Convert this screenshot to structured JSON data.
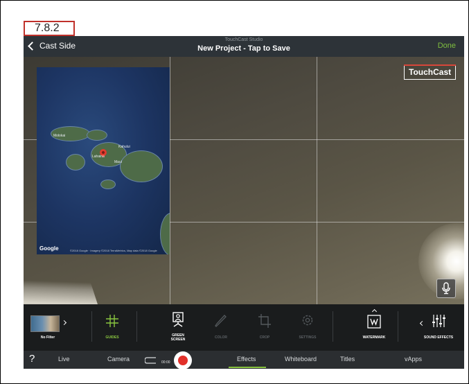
{
  "step_label": "7.8.2",
  "topbar": {
    "back_label": "Cast Side",
    "app_name": "TouchCast Studio",
    "project_title": "New Project - Tap to Save",
    "done_label": "Done"
  },
  "preview": {
    "logo_text": "TouchCast",
    "map": {
      "google_label": "Google",
      "attribution": "©2018 Google · Imagery ©2018 TerraMetrics, Map data ©2018 Google",
      "place_labels": [
        "Molokai",
        "Kahului",
        "Lahaina",
        "Maui"
      ]
    }
  },
  "effects": {
    "filter_label": "No Filter",
    "guides_label": "GUIDES",
    "green_screen_label": "GREEN\nSCREEN",
    "color_label": "COLOR",
    "crop_label": "CROP",
    "settings_label": "SETTINGS",
    "watermark_label": "WATERMARK",
    "sound_effects_label": "SOUND EFFECTS"
  },
  "bottombar": {
    "help": "?",
    "live": "Live",
    "camera": "Camera",
    "timer": "00:00",
    "tabs": [
      "Effects",
      "Whiteboard",
      "Titles",
      "vApps"
    ]
  },
  "colors": {
    "accent_green": "#8ac640",
    "record_red": "#e2302a",
    "label_border": "#c0302a"
  }
}
